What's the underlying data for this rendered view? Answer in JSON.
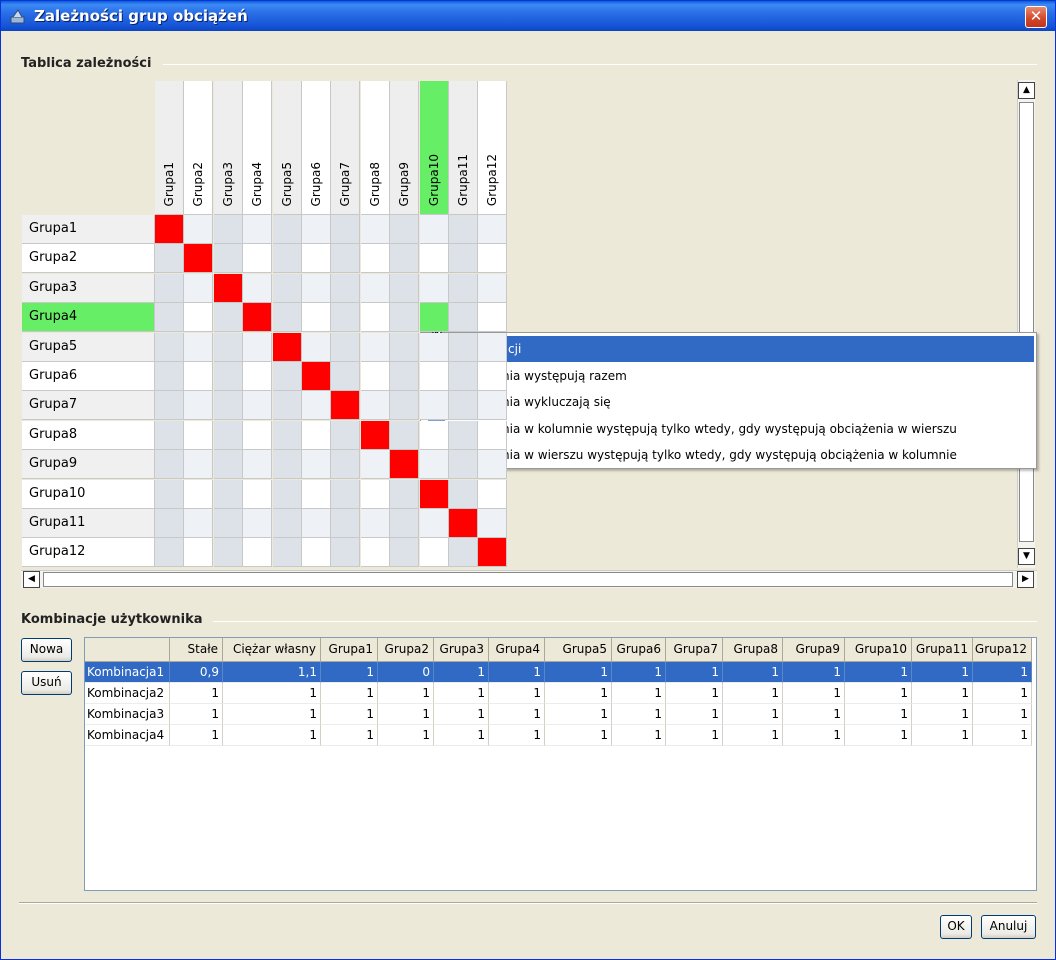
{
  "window": {
    "title": "Zależności grup obciążeń",
    "close_label": "✕"
  },
  "matrix_section": {
    "label": "Tablica zależności",
    "groups": [
      "Grupa1",
      "Grupa2",
      "Grupa3",
      "Grupa4",
      "Grupa5",
      "Grupa6",
      "Grupa7",
      "Grupa8",
      "Grupa9",
      "Grupa10",
      "Grupa11",
      "Grupa12"
    ],
    "highlight_row": "Grupa4",
    "highlight_col": "Grupa10",
    "colors": {
      "diagonal": "#ff0000",
      "highlight": "#66ee66",
      "alt": "#dde2e8",
      "alt2": "#eef1f5",
      "white": "#ffffff"
    }
  },
  "context_menu": {
    "items": [
      {
        "label": "Brak relacji",
        "icon": "none",
        "selected": true
      },
      {
        "label": "Obciążenia występują razem",
        "icon": "plus-icon",
        "selected": false
      },
      {
        "label": "Obciążenia wykluczają się",
        "icon": "minus-icon",
        "selected": false
      },
      {
        "label": "Obciążenia w kolumnie występują tylko wtedy, gdy występują obciążenia w wierszu",
        "icon": "arrow-up-icon",
        "selected": false
      },
      {
        "label": "Obciążenia w wierszu występują tylko wtedy, gdy występują obciążenia w kolumnie",
        "icon": "arrow-return-icon",
        "selected": false
      }
    ]
  },
  "combinations_section": {
    "label": "Kombinacje użytkownika",
    "new_button": "Nowa",
    "delete_button": "Usuń",
    "columns": [
      "",
      "Stałe",
      "Ciężar własny",
      "Grupa1",
      "Grupa2",
      "Grupa3",
      "Grupa4",
      "Grupa5",
      "Grupa6",
      "Grupa7",
      "Grupa8",
      "Grupa9",
      "Grupa10",
      "Grupa11",
      "Grupa12"
    ],
    "rows": [
      {
        "name": "Kombinacja1",
        "values": [
          "0,9",
          "1,1",
          "1",
          "0",
          "1",
          "1",
          "1",
          "1",
          "1",
          "1",
          "1",
          "1",
          "1",
          "1"
        ],
        "selected": true
      },
      {
        "name": "Kombinacja2",
        "values": [
          "1",
          "1",
          "1",
          "1",
          "1",
          "1",
          "1",
          "1",
          "1",
          "1",
          "1",
          "1",
          "1",
          "1"
        ],
        "selected": false
      },
      {
        "name": "Kombinacja3",
        "values": [
          "1",
          "1",
          "1",
          "1",
          "1",
          "1",
          "1",
          "1",
          "1",
          "1",
          "1",
          "1",
          "1",
          "1"
        ],
        "selected": false
      },
      {
        "name": "Kombinacja4",
        "values": [
          "1",
          "1",
          "1",
          "1",
          "1",
          "1",
          "1",
          "1",
          "1",
          "1",
          "1",
          "1",
          "1",
          "1"
        ],
        "selected": false
      }
    ]
  },
  "footer": {
    "ok_button": "OK",
    "cancel_button": "Anuluj"
  }
}
